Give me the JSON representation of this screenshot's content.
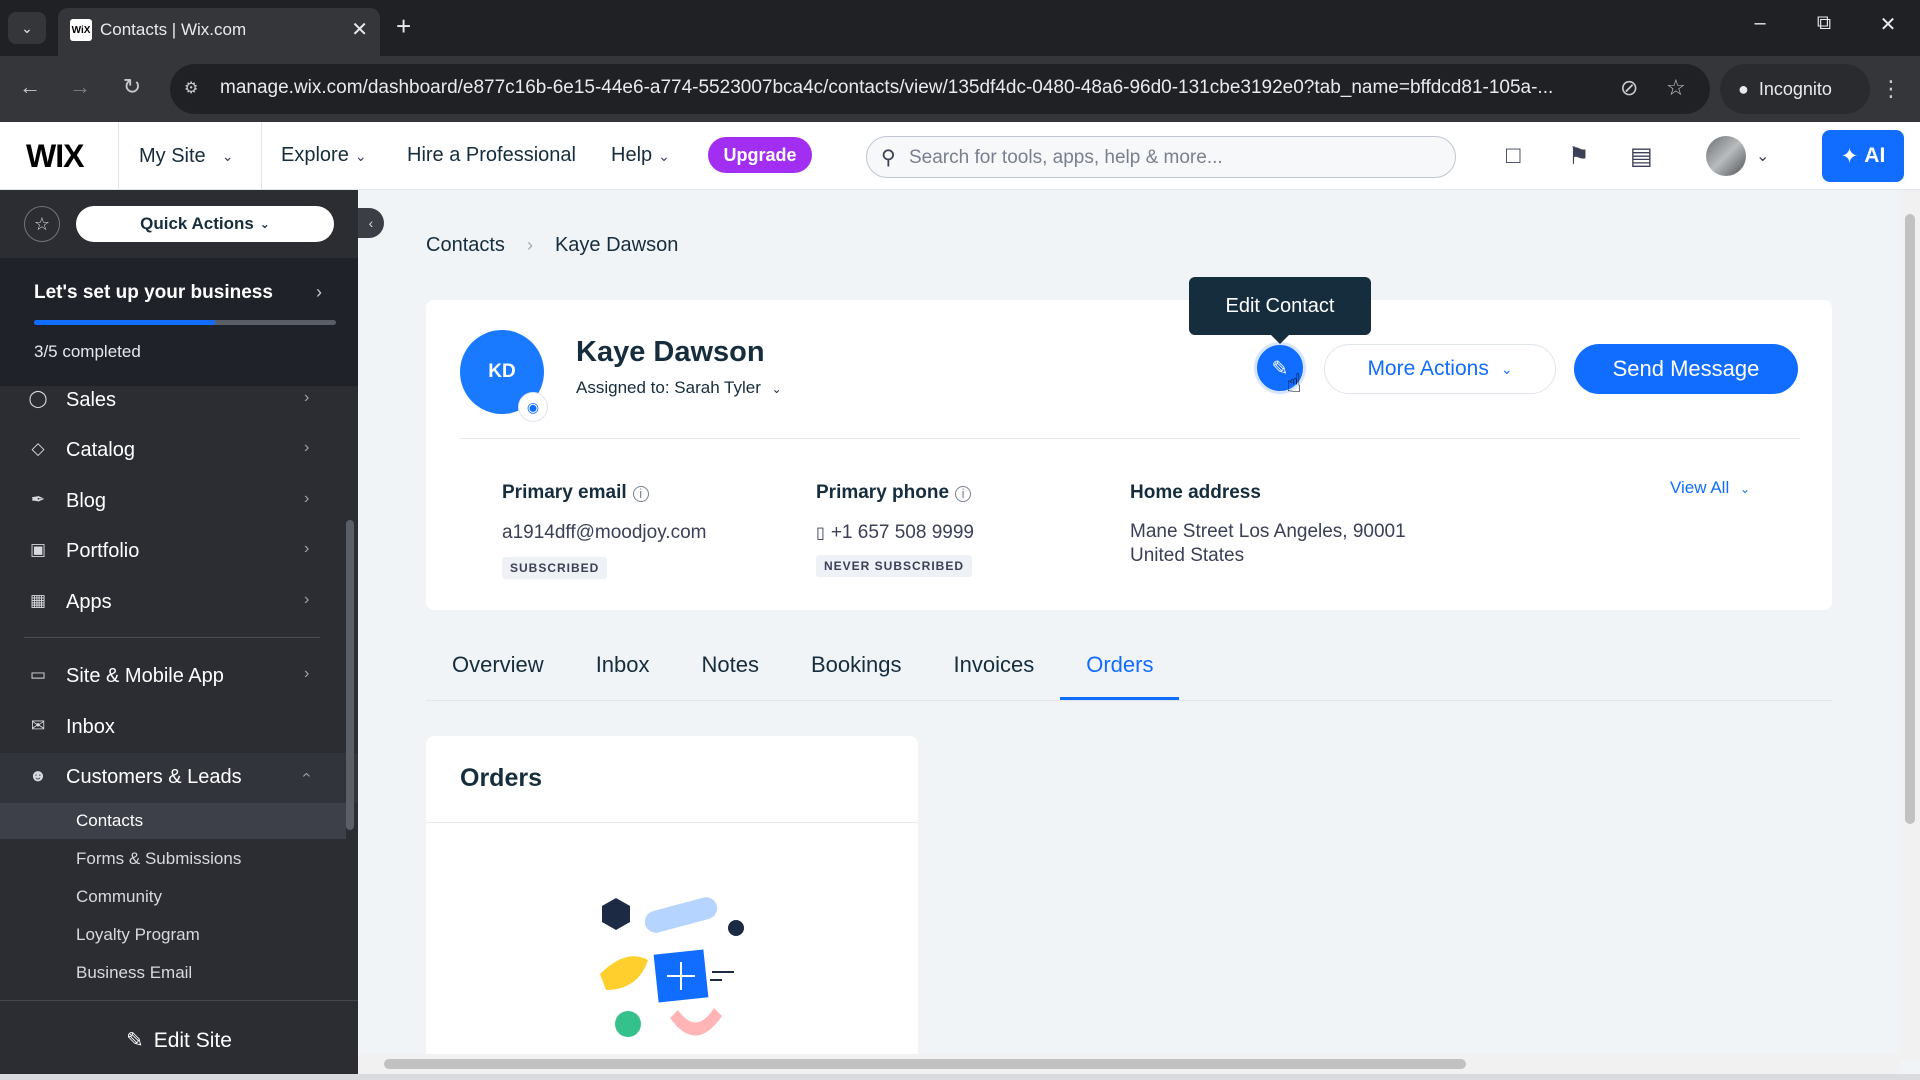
{
  "browser": {
    "tab_title": "Contacts | Wix.com",
    "favicon_text": "WiX",
    "url": "manage.wix.com/dashboard/e877c16b-6e15-44e6-a774-5523007bca4c/contacts/view/135df4dc-0480-48a6-96d0-131cbe3192e0?tab_name=bffdcd81-105a-...",
    "incognito_label": "Incognito"
  },
  "topbar": {
    "logo": "WIX",
    "my_site": "My Site",
    "explore": "Explore",
    "hire": "Hire a Professional",
    "help": "Help",
    "upgrade": "Upgrade",
    "search_placeholder": "Search for tools, apps, help & more...",
    "ai": "AI"
  },
  "sidebar": {
    "quick_actions": "Quick Actions",
    "setup_title": "Let's set up your business",
    "setup_progress": 0.6,
    "setup_count": "3/5 completed",
    "items": [
      {
        "label": "Sales",
        "icon": "sales-icon"
      },
      {
        "label": "Catalog",
        "icon": "catalog-icon"
      },
      {
        "label": "Blog",
        "icon": "blog-icon"
      },
      {
        "label": "Portfolio",
        "icon": "portfolio-icon"
      },
      {
        "label": "Apps",
        "icon": "apps-icon"
      },
      {
        "label": "Site & Mobile App",
        "icon": "site-mobile-icon"
      },
      {
        "label": "Inbox",
        "icon": "inbox-icon"
      },
      {
        "label": "Customers & Leads",
        "icon": "customers-icon"
      }
    ],
    "sub_items": [
      "Contacts",
      "Forms & Submissions",
      "Community",
      "Loyalty Program",
      "Business Email"
    ],
    "active_sub": "Contacts",
    "edit_site": "Edit Site"
  },
  "breadcrumb": {
    "root": "Contacts",
    "current": "Kaye Dawson"
  },
  "contact": {
    "initials": "KD",
    "name": "Kaye Dawson",
    "assigned": "Assigned to: Sarah Tyler",
    "more_actions": "More Actions",
    "send_message": "Send Message",
    "tooltip": "Edit Contact",
    "email_label": "Primary email",
    "email": "a1914dff@moodjoy.com",
    "email_status": "SUBSCRIBED",
    "phone_label": "Primary phone",
    "phone": "+1 657 508 9999",
    "phone_status": "NEVER SUBSCRIBED",
    "address_label": "Home address",
    "address_line1": "Mane Street Los Angeles, 90001",
    "address_line2": "United States",
    "view_all": "View All"
  },
  "tabs": [
    "Overview",
    "Inbox",
    "Notes",
    "Bookings",
    "Invoices",
    "Orders"
  ],
  "active_tab": "Orders",
  "orders": {
    "title": "Orders"
  },
  "colors": {
    "accent": "#116dff",
    "upgrade": "#a12ef1",
    "sidebar": "#2b2d33"
  }
}
